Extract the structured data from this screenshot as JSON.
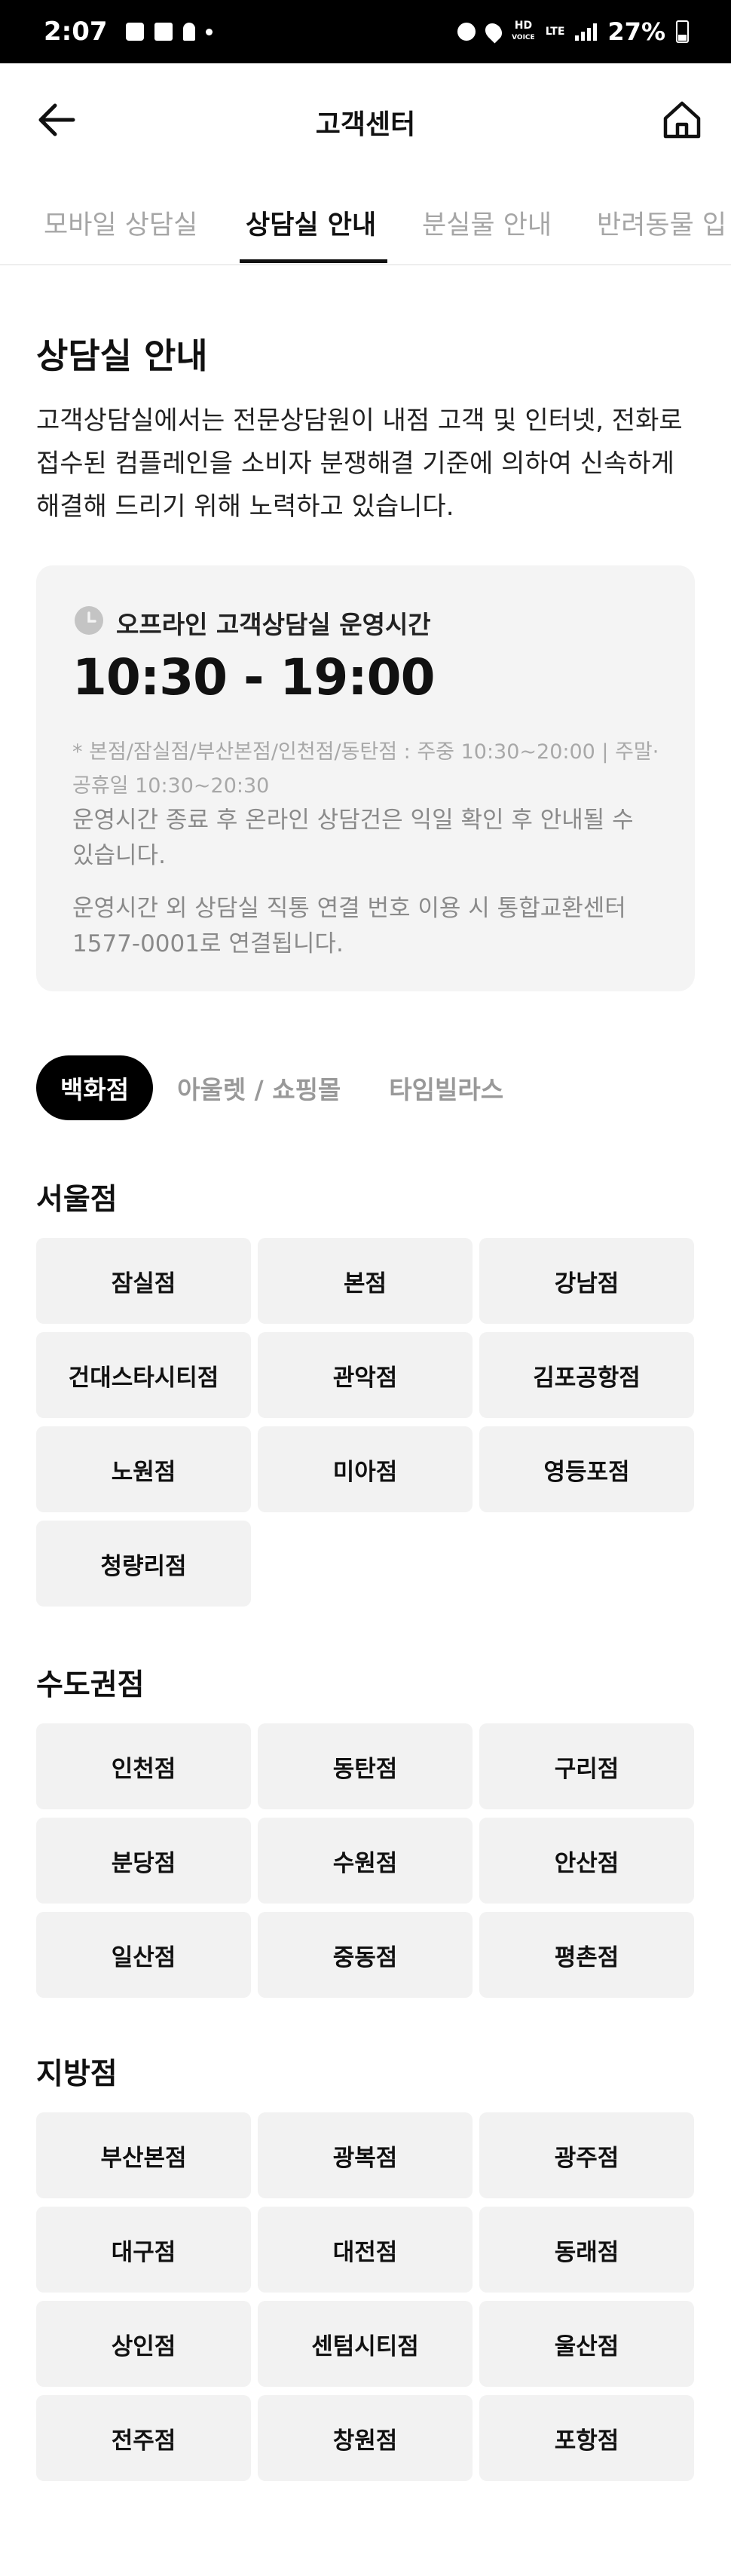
{
  "status_bar": {
    "time": "2:07",
    "network_hd": "HD",
    "network_voice": "VOICE",
    "network_lte": "LTE",
    "battery": "27%"
  },
  "header": {
    "title": "고객센터",
    "back_icon": "arrow-left-icon",
    "home_icon": "home-icon"
  },
  "tabs": [
    {
      "label": "모바일 상담실",
      "active": false
    },
    {
      "label": "상담실 안내",
      "active": true
    },
    {
      "label": "분실물 안내",
      "active": false
    },
    {
      "label": "반려동물 입",
      "active": false
    }
  ],
  "section": {
    "title": "상담실 안내",
    "description": "고객상담실에서는 전문상담원이 내점 고객 및 인터넷, 전화로 접수된 컴플레인을 소비자 분쟁해결 기준에 의하여 신속하게 해결해 드리기 위해 노력하고 있습니다."
  },
  "info_card": {
    "label": "오프라인 고객상담실 운영시간",
    "hours": "10:30 - 19:00",
    "note1": "* 본점/잠실점/부산본점/인천점/동탄점 : 주중 10:30~20:00 | 주말·공휴일 10:30~20:30",
    "note2": "운영시간 종료 후 온라인 상담건은 익일 확인 후 안내될 수 있습니다.",
    "note3": "운영시간 외 상담실 직통 연결 번호 이용 시 통합교환센터 1577-0001로 연결됩니다."
  },
  "categories": [
    {
      "label": "백화점",
      "active": true
    },
    {
      "label": "아울렛 / 쇼핑몰",
      "active": false
    },
    {
      "label": "타임빌라스",
      "active": false
    }
  ],
  "regions": [
    {
      "title": "서울점",
      "stores": [
        "잠실점",
        "본점",
        "강남점",
        "건대스타시티점",
        "관악점",
        "김포공항점",
        "노원점",
        "미아점",
        "영등포점",
        "청량리점"
      ]
    },
    {
      "title": "수도권점",
      "stores": [
        "인천점",
        "동탄점",
        "구리점",
        "분당점",
        "수원점",
        "안산점",
        "일산점",
        "중동점",
        "평촌점"
      ]
    },
    {
      "title": "지방점",
      "stores": [
        "부산본점",
        "광복점",
        "광주점",
        "대구점",
        "대전점",
        "동래점",
        "상인점",
        "센텀시티점",
        "울산점",
        "전주점",
        "창원점",
        "포항점"
      ]
    }
  ]
}
